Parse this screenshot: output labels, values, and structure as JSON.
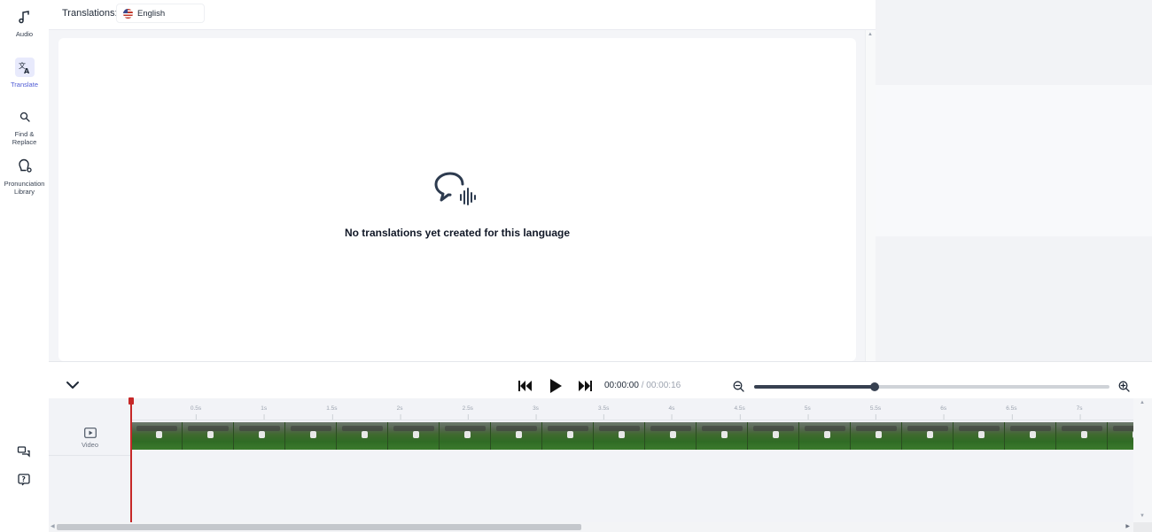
{
  "sidebar": {
    "items": [
      {
        "label": "Audio",
        "icon": "music-note-icon"
      },
      {
        "label": "Translate",
        "icon": "translate-icon",
        "active": true
      },
      {
        "label": "Find & Replace",
        "icon": "search-icon"
      },
      {
        "label": "Pronunciation Library",
        "icon": "pronunciation-icon"
      }
    ],
    "bottom_icons": [
      "feedback-icon",
      "help-icon"
    ]
  },
  "topbar": {
    "translations_label": "Translations:",
    "language": "English",
    "language_flag_icon": "us-flag-icon"
  },
  "main": {
    "empty_icon": "speech-bubble-waveform-icon",
    "empty_message": "No translations yet created for this language"
  },
  "player": {
    "collapse_icon": "chevron-down-icon",
    "current_time": "00:00:00",
    "separator": " / ",
    "duration": "00:00:16",
    "zoom_out_icon": "zoom-out-icon",
    "zoom_in_icon": "zoom-in-icon",
    "zoom_level": 0.34
  },
  "timeline": {
    "ruler_ticks": [
      "0.5s",
      "1s",
      "1.5s",
      "2s",
      "2.5s",
      "3s",
      "3.5s",
      "4s",
      "4.5s",
      "5s",
      "5.5s",
      "6s",
      "6.5s",
      "7s"
    ],
    "tracks": [
      {
        "label": "Video",
        "icon": "video-play-icon"
      }
    ]
  },
  "colors": {
    "accent": "#4f5bd5",
    "playhead": "#c62828",
    "slider": "#374151"
  }
}
